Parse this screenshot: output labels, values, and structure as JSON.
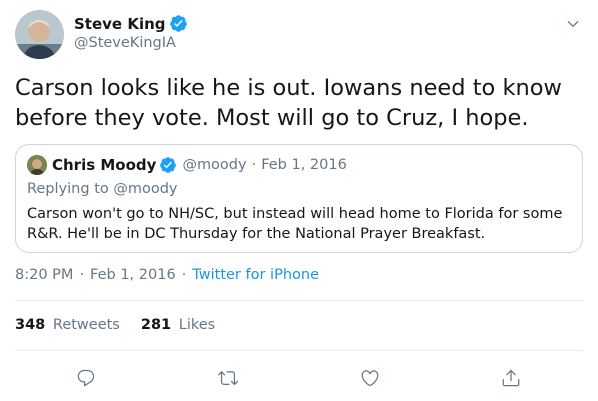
{
  "author": {
    "name": "Steve King",
    "handle": "@SteveKingIA"
  },
  "tweet": {
    "text": "Carson looks like he is out. Iowans need to know before they vote. Most will go to Cruz, I hope."
  },
  "quoted_tweet": {
    "name": "Chris Moody",
    "handle": "@moody",
    "separator": "·",
    "date": "Feb 1, 2016",
    "replying_to": "Replying to @moody",
    "text": "Carson won't go to NH/SC, but instead will head home to Florida for some R&R. He'll be in DC Thursday for the National Prayer Breakfast."
  },
  "meta": {
    "time": "8:20 PM",
    "sep1": "·",
    "date": "Feb 1, 2016",
    "sep2": "·",
    "source": "Twitter for iPhone"
  },
  "stats": {
    "retweets_count": "348",
    "retweets_label": "Retweets",
    "likes_count": "281",
    "likes_label": "Likes"
  },
  "actions": {
    "icons": [
      "reply-icon",
      "retweet-icon",
      "like-icon",
      "share-icon"
    ]
  },
  "colors": {
    "text": "#14171a",
    "secondary": "#657786",
    "link": "#1b95e0",
    "border": "#ccd6dd",
    "verified": "#1da1f2"
  }
}
